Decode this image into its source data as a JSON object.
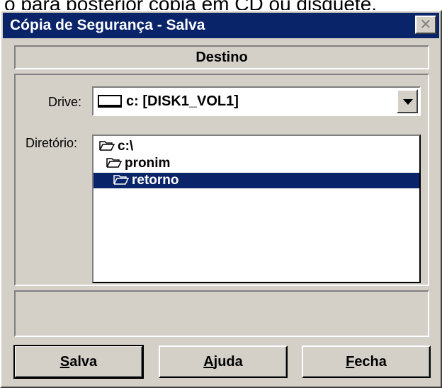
{
  "background_caption": "o para posterior cópia em CD ou disquete.",
  "window": {
    "title": "Cópia de Segurança - Salva",
    "close_glyph": "✕"
  },
  "header": {
    "label": "Destino"
  },
  "drive": {
    "label": "Drive:",
    "selected": "c: [DISK1_VOL1]"
  },
  "directory": {
    "label": "Diretório:",
    "items": [
      {
        "text": "c:\\",
        "selected": false
      },
      {
        "text": "pronim",
        "selected": false
      },
      {
        "text": "retorno",
        "selected": true
      }
    ]
  },
  "buttons": {
    "salva": {
      "hotkey": "S",
      "rest": "alva"
    },
    "ajuda": {
      "hotkey": "A",
      "rest": "juda"
    },
    "fecha": {
      "hotkey": "F",
      "rest": "echa"
    }
  },
  "colors": {
    "title_bg": "#0a246a",
    "face": "#d4d0c8",
    "selection": "#0a246a"
  }
}
